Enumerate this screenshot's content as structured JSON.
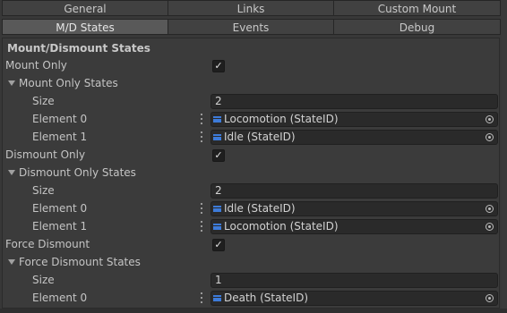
{
  "tabs_row1": [
    "General",
    "Links",
    "Custom Mount"
  ],
  "tabs_row2": [
    "M/D States",
    "Events",
    "Debug"
  ],
  "selected_tab": "M/D States",
  "section_title": "Mount/Dismount States",
  "mount_only": {
    "label": "Mount Only",
    "checked": true
  },
  "mount_only_states": {
    "label": "Mount Only States",
    "size_label": "Size",
    "size": "2",
    "elements": [
      {
        "label": "Element 0",
        "value": "Locomotion (StateID)"
      },
      {
        "label": "Element 1",
        "value": "Idle (StateID)"
      }
    ]
  },
  "dismount_only": {
    "label": "Dismount Only",
    "checked": true
  },
  "dismount_only_states": {
    "label": "Dismount Only States",
    "size_label": "Size",
    "size": "2",
    "elements": [
      {
        "label": "Element 0",
        "value": "Idle (StateID)"
      },
      {
        "label": "Element 1",
        "value": "Locomotion (StateID)"
      }
    ]
  },
  "force_dismount": {
    "label": "Force Dismount",
    "checked": true
  },
  "force_dismount_states": {
    "label": "Force Dismount States",
    "size_label": "Size",
    "size": "1",
    "elements": [
      {
        "label": "Element 0",
        "value": "Death (StateID)"
      }
    ]
  },
  "check_glyph": "✓",
  "colors": {
    "accent_icon": "#3d7bd9",
    "selected_tab": "#595959",
    "panel": "#3b3b3b"
  },
  "icons": {
    "foldout": "triangle-down-icon",
    "object": "scriptable-object-icon",
    "picker": "object-picker-icon",
    "drag": "drag-handle-icon"
  }
}
